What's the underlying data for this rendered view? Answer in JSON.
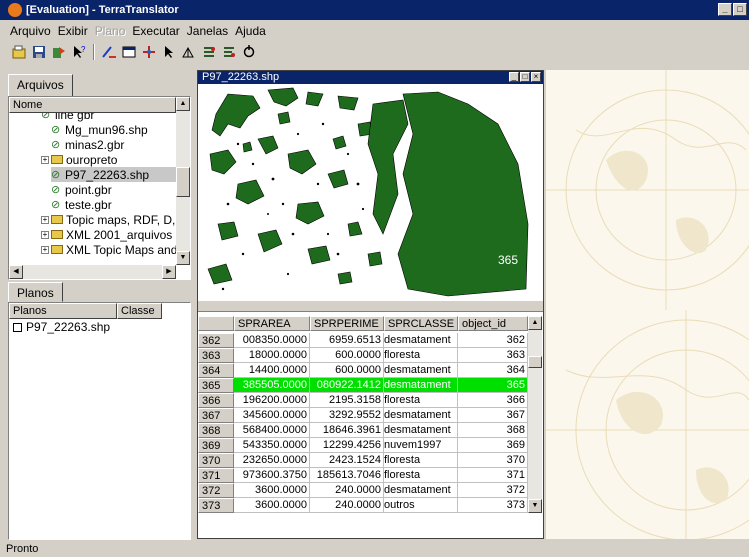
{
  "window": {
    "title": "[Evaluation] - TerraTranslator"
  },
  "menu": [
    {
      "label": "Arquivo",
      "enabled": true
    },
    {
      "label": "Exibir",
      "enabled": true
    },
    {
      "label": "Plano",
      "enabled": false
    },
    {
      "label": "Executar",
      "enabled": true
    },
    {
      "label": "Janelas",
      "enabled": true
    },
    {
      "label": "Ajuda",
      "enabled": true
    }
  ],
  "toolbar": {
    "icons": [
      "open-icon",
      "save-icon",
      "import-icon",
      "help-pointer-icon",
      "draw-icon",
      "window-icon",
      "pan-icon",
      "select-arrow-icon",
      "zoom-icon",
      "layers-icon",
      "query-icon",
      "refresh-icon"
    ]
  },
  "files_panel": {
    "tab": "Arquivos",
    "header": "Nome",
    "items": [
      {
        "label": "line gbr",
        "type": "file"
      },
      {
        "label": "Mg_mun96.shp",
        "type": "file"
      },
      {
        "label": "minas2.gbr",
        "type": "file"
      },
      {
        "label": "ouropreto",
        "type": "folder"
      },
      {
        "label": "P97_22263.shp",
        "type": "file",
        "selected": true
      },
      {
        "label": "point.gbr",
        "type": "file"
      },
      {
        "label": "teste.gbr",
        "type": "file"
      },
      {
        "label": "Topic maps, RDF, D,",
        "type": "folder"
      },
      {
        "label": "XML 2001_arquivos",
        "type": "folder"
      },
      {
        "label": "XML Topic Maps and",
        "type": "folder"
      }
    ]
  },
  "layers_panel": {
    "tab": "Planos",
    "columns": [
      "Planos",
      "Classe"
    ],
    "items": [
      {
        "label": "P97_22263.shp"
      }
    ]
  },
  "child_window": {
    "title": "P97_22263.shp",
    "map_label": "365",
    "colors": {
      "polygon": "#1e6b1e",
      "selected_row": "#00e000"
    }
  },
  "table": {
    "columns": [
      "",
      "SPRAREA",
      "SPRPERIME",
      "SPRCLASSE",
      "object_id"
    ],
    "rows": [
      {
        "id": "362",
        "area": "008350.0000",
        "perim": "6959.6513",
        "classe": "desmatament",
        "obj": "362",
        "selected": false
      },
      {
        "id": "363",
        "area": "18000.0000",
        "perim": "600.0000",
        "classe": "floresta",
        "obj": "363",
        "selected": false
      },
      {
        "id": "364",
        "area": "14400.0000",
        "perim": "600.0000",
        "classe": "desmatament",
        "obj": "364",
        "selected": false
      },
      {
        "id": "365",
        "area": "385505.0000",
        "perim": "080922.1412",
        "classe": "desmatament",
        "obj": "365",
        "selected": true
      },
      {
        "id": "366",
        "area": "196200.0000",
        "perim": "2195.3158",
        "classe": "floresta",
        "obj": "366",
        "selected": false
      },
      {
        "id": "367",
        "area": "345600.0000",
        "perim": "3292.9552",
        "classe": "desmatament",
        "obj": "367",
        "selected": false
      },
      {
        "id": "368",
        "area": "568400.0000",
        "perim": "18646.3961",
        "classe": "desmatament",
        "obj": "368",
        "selected": false
      },
      {
        "id": "369",
        "area": "543350.0000",
        "perim": "12299.4256",
        "classe": "nuvem1997",
        "obj": "369",
        "selected": false
      },
      {
        "id": "370",
        "area": "232650.0000",
        "perim": "2423.1524",
        "classe": "floresta",
        "obj": "370",
        "selected": false
      },
      {
        "id": "371",
        "area": "973600.3750",
        "perim": "185613.7046",
        "classe": "floresta",
        "obj": "371",
        "selected": false
      },
      {
        "id": "372",
        "area": "3600.0000",
        "perim": "240.0000",
        "classe": "desmatament",
        "obj": "372",
        "selected": false
      },
      {
        "id": "373",
        "area": "3600.0000",
        "perim": "240.0000",
        "classe": "outros",
        "obj": "373",
        "selected": false
      }
    ]
  },
  "status": {
    "text": "Pronto"
  }
}
